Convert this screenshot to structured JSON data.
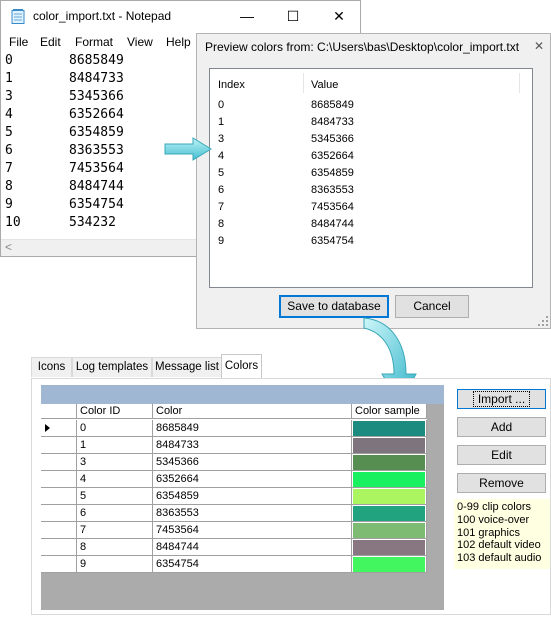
{
  "notepad": {
    "title": "color_import.txt - Notepad",
    "controls": [
      "—",
      "☐",
      "✕"
    ],
    "menu": [
      "File",
      "Edit",
      "Format",
      "View",
      "Help"
    ],
    "lines": [
      {
        "index": "0",
        "value": "8685849"
      },
      {
        "index": "1",
        "value": "8484733"
      },
      {
        "index": "3",
        "value": "5345366"
      },
      {
        "index": "4",
        "value": "6352664"
      },
      {
        "index": "5",
        "value": "6354859"
      },
      {
        "index": "6",
        "value": "8363553"
      },
      {
        "index": "7",
        "value": "7453564"
      },
      {
        "index": "8",
        "value": "8484744"
      },
      {
        "index": "9",
        "value": "6354754"
      },
      {
        "index": "10",
        "value": "534232"
      }
    ],
    "scroll_left": "<"
  },
  "preview": {
    "title": "Preview colors from: C:\\Users\\bas\\Desktop\\color_import.txt",
    "close": "✕",
    "columns": [
      "Index",
      "Value"
    ],
    "rows": [
      {
        "index": "0",
        "value": "8685849"
      },
      {
        "index": "1",
        "value": "8484733"
      },
      {
        "index": "3",
        "value": "5345366"
      },
      {
        "index": "4",
        "value": "6352664"
      },
      {
        "index": "5",
        "value": "6354859"
      },
      {
        "index": "6",
        "value": "8363553"
      },
      {
        "index": "7",
        "value": "7453564"
      },
      {
        "index": "8",
        "value": "8484744"
      },
      {
        "index": "9",
        "value": "6354754"
      }
    ],
    "save_label": "Save to database",
    "cancel_label": "Cancel"
  },
  "colors_panel": {
    "tabs": [
      "Icons",
      "Log templates",
      "Message list",
      "Colors"
    ],
    "active_tab": "Colors",
    "columns": [
      "Color ID",
      "Color",
      "Color sample"
    ],
    "rows": [
      {
        "id": "0",
        "color": "8685849",
        "sample": "#1b8a7f"
      },
      {
        "id": "1",
        "color": "8484733",
        "sample": "#7d747d"
      },
      {
        "id": "3",
        "color": "5345366",
        "sample": "#568e51"
      },
      {
        "id": "4",
        "color": "6352664",
        "sample": "#18f060"
      },
      {
        "id": "5",
        "color": "6354859",
        "sample": "#abf660"
      },
      {
        "id": "6",
        "color": "8363553",
        "sample": "#21a37f"
      },
      {
        "id": "7",
        "color": "7453564",
        "sample": "#7cbb71"
      },
      {
        "id": "8",
        "color": "8484744",
        "sample": "#887781"
      },
      {
        "id": "9",
        "color": "6354754",
        "sample": "#42f660"
      }
    ],
    "buttons": {
      "import": "Import ...",
      "add": "Add",
      "edit": "Edit",
      "remove": "Remove"
    },
    "legend": [
      "0-99 clip colors",
      "100 voice-over",
      "101 graphics",
      "102 default video",
      "103 default audio"
    ]
  },
  "accent": "#0078d7",
  "band_color": "#9fb7d3",
  "legend_bg": "#ffffe1"
}
